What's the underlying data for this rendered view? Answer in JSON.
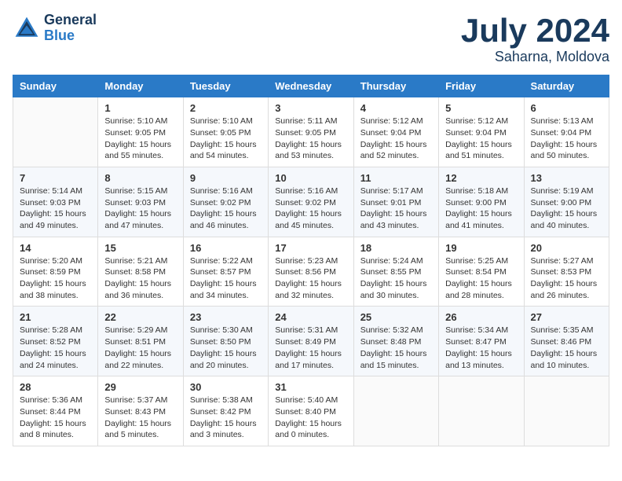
{
  "header": {
    "logo_line1": "General",
    "logo_line2": "Blue",
    "month": "July 2024",
    "location": "Saharna, Moldova"
  },
  "weekdays": [
    "Sunday",
    "Monday",
    "Tuesday",
    "Wednesday",
    "Thursday",
    "Friday",
    "Saturday"
  ],
  "weeks": [
    [
      {
        "day": "",
        "info": ""
      },
      {
        "day": "1",
        "info": "Sunrise: 5:10 AM\nSunset: 9:05 PM\nDaylight: 15 hours\nand 55 minutes."
      },
      {
        "day": "2",
        "info": "Sunrise: 5:10 AM\nSunset: 9:05 PM\nDaylight: 15 hours\nand 54 minutes."
      },
      {
        "day": "3",
        "info": "Sunrise: 5:11 AM\nSunset: 9:05 PM\nDaylight: 15 hours\nand 53 minutes."
      },
      {
        "day": "4",
        "info": "Sunrise: 5:12 AM\nSunset: 9:04 PM\nDaylight: 15 hours\nand 52 minutes."
      },
      {
        "day": "5",
        "info": "Sunrise: 5:12 AM\nSunset: 9:04 PM\nDaylight: 15 hours\nand 51 minutes."
      },
      {
        "day": "6",
        "info": "Sunrise: 5:13 AM\nSunset: 9:04 PM\nDaylight: 15 hours\nand 50 minutes."
      }
    ],
    [
      {
        "day": "7",
        "info": "Sunrise: 5:14 AM\nSunset: 9:03 PM\nDaylight: 15 hours\nand 49 minutes."
      },
      {
        "day": "8",
        "info": "Sunrise: 5:15 AM\nSunset: 9:03 PM\nDaylight: 15 hours\nand 47 minutes."
      },
      {
        "day": "9",
        "info": "Sunrise: 5:16 AM\nSunset: 9:02 PM\nDaylight: 15 hours\nand 46 minutes."
      },
      {
        "day": "10",
        "info": "Sunrise: 5:16 AM\nSunset: 9:02 PM\nDaylight: 15 hours\nand 45 minutes."
      },
      {
        "day": "11",
        "info": "Sunrise: 5:17 AM\nSunset: 9:01 PM\nDaylight: 15 hours\nand 43 minutes."
      },
      {
        "day": "12",
        "info": "Sunrise: 5:18 AM\nSunset: 9:00 PM\nDaylight: 15 hours\nand 41 minutes."
      },
      {
        "day": "13",
        "info": "Sunrise: 5:19 AM\nSunset: 9:00 PM\nDaylight: 15 hours\nand 40 minutes."
      }
    ],
    [
      {
        "day": "14",
        "info": "Sunrise: 5:20 AM\nSunset: 8:59 PM\nDaylight: 15 hours\nand 38 minutes."
      },
      {
        "day": "15",
        "info": "Sunrise: 5:21 AM\nSunset: 8:58 PM\nDaylight: 15 hours\nand 36 minutes."
      },
      {
        "day": "16",
        "info": "Sunrise: 5:22 AM\nSunset: 8:57 PM\nDaylight: 15 hours\nand 34 minutes."
      },
      {
        "day": "17",
        "info": "Sunrise: 5:23 AM\nSunset: 8:56 PM\nDaylight: 15 hours\nand 32 minutes."
      },
      {
        "day": "18",
        "info": "Sunrise: 5:24 AM\nSunset: 8:55 PM\nDaylight: 15 hours\nand 30 minutes."
      },
      {
        "day": "19",
        "info": "Sunrise: 5:25 AM\nSunset: 8:54 PM\nDaylight: 15 hours\nand 28 minutes."
      },
      {
        "day": "20",
        "info": "Sunrise: 5:27 AM\nSunset: 8:53 PM\nDaylight: 15 hours\nand 26 minutes."
      }
    ],
    [
      {
        "day": "21",
        "info": "Sunrise: 5:28 AM\nSunset: 8:52 PM\nDaylight: 15 hours\nand 24 minutes."
      },
      {
        "day": "22",
        "info": "Sunrise: 5:29 AM\nSunset: 8:51 PM\nDaylight: 15 hours\nand 22 minutes."
      },
      {
        "day": "23",
        "info": "Sunrise: 5:30 AM\nSunset: 8:50 PM\nDaylight: 15 hours\nand 20 minutes."
      },
      {
        "day": "24",
        "info": "Sunrise: 5:31 AM\nSunset: 8:49 PM\nDaylight: 15 hours\nand 17 minutes."
      },
      {
        "day": "25",
        "info": "Sunrise: 5:32 AM\nSunset: 8:48 PM\nDaylight: 15 hours\nand 15 minutes."
      },
      {
        "day": "26",
        "info": "Sunrise: 5:34 AM\nSunset: 8:47 PM\nDaylight: 15 hours\nand 13 minutes."
      },
      {
        "day": "27",
        "info": "Sunrise: 5:35 AM\nSunset: 8:46 PM\nDaylight: 15 hours\nand 10 minutes."
      }
    ],
    [
      {
        "day": "28",
        "info": "Sunrise: 5:36 AM\nSunset: 8:44 PM\nDaylight: 15 hours\nand 8 minutes."
      },
      {
        "day": "29",
        "info": "Sunrise: 5:37 AM\nSunset: 8:43 PM\nDaylight: 15 hours\nand 5 minutes."
      },
      {
        "day": "30",
        "info": "Sunrise: 5:38 AM\nSunset: 8:42 PM\nDaylight: 15 hours\nand 3 minutes."
      },
      {
        "day": "31",
        "info": "Sunrise: 5:40 AM\nSunset: 8:40 PM\nDaylight: 15 hours\nand 0 minutes."
      },
      {
        "day": "",
        "info": ""
      },
      {
        "day": "",
        "info": ""
      },
      {
        "day": "",
        "info": ""
      }
    ]
  ]
}
